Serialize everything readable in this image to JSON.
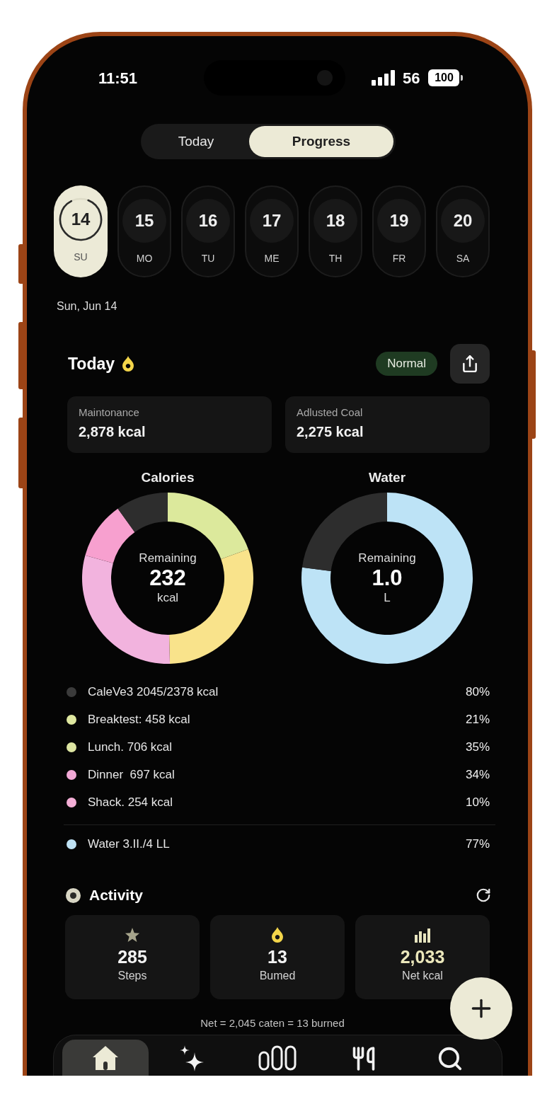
{
  "status_bar": {
    "time": "11:51",
    "signal_text": "56",
    "battery": "100"
  },
  "tabs": [
    {
      "label": "Today",
      "selected": false
    },
    {
      "label": "Progress",
      "selected": true
    }
  ],
  "days": [
    {
      "number": "14",
      "label": "SU",
      "selected": true,
      "level": 0.92
    },
    {
      "number": "15",
      "label": "MO",
      "selected": false
    },
    {
      "number": "16",
      "label": "TU",
      "selected": false
    },
    {
      "number": "17",
      "label": "ME",
      "selected": false
    },
    {
      "number": "18",
      "label": "TH",
      "selected": false
    },
    {
      "number": "19",
      "label": "FR",
      "selected": false
    },
    {
      "number": "20",
      "label": "SA",
      "selected": false
    }
  ],
  "date": "Sun, Jun 14",
  "today": {
    "title": "Today",
    "badge": "Normal",
    "cards": [
      {
        "label": "Maintonance",
        "value": "2,878 kcal"
      },
      {
        "label": "Adlusted Coal",
        "value": "2,275 kcal"
      }
    ]
  },
  "charts": [
    {
      "center": {
        "label": "Remaining",
        "value": "232",
        "unit": "kcal"
      },
      "chart_data": {
        "type": "donut",
        "title": "Calories",
        "values": [
          19.5,
          30.1,
          29.7,
          10.8,
          9.9
        ],
        "colors": [
          "#dce99c",
          "#f9e38b",
          "#f2b3de",
          "#f7a0cf",
          "#2d2d2d"
        ]
      }
    },
    {
      "center": {
        "label": "Remaining",
        "value": "1.0",
        "unit": "L"
      },
      "chart_data": {
        "type": "donut",
        "title": "Water",
        "values": [
          77,
          23
        ],
        "colors": [
          "#bde3f6",
          "#2d2d2d"
        ]
      }
    }
  ],
  "legend": [
    {
      "text": "CaleVe3 2045/2378 kcal",
      "percent": "80%",
      "color": "#3b3b3b"
    },
    {
      "text": "Breaktest: 458 kcal",
      "percent": "21%",
      "color": "#dfe8a0"
    },
    {
      "text": "Lunch. 706 kcal",
      "percent": "35%",
      "color": "#dde5a2"
    },
    {
      "text": "Dinner  697 kcal",
      "percent": "34%",
      "color": "#f2a9d6"
    },
    {
      "text": "Shack. 254 kcal",
      "percent": "10%",
      "color": "#f4aed6"
    }
  ],
  "water_legend": {
    "text": "Water 3.II./4 LL",
    "percent": "77%",
    "color": "#bfe2f4"
  },
  "activity": {
    "title": "Activity",
    "cards": [
      {
        "kind": "steps",
        "value": "285",
        "label": "Steps"
      },
      {
        "kind": "burned",
        "value": "13",
        "label": "Bumed"
      },
      {
        "kind": "net",
        "value": "2,033",
        "label": "Net kcal"
      }
    ],
    "note": "Net = 2,045 caten = 13 burned"
  },
  "nav": [
    {
      "selected": true
    },
    {
      "selected": false
    },
    {
      "selected": false
    },
    {
      "selected": false
    },
    {
      "selected": false
    }
  ]
}
